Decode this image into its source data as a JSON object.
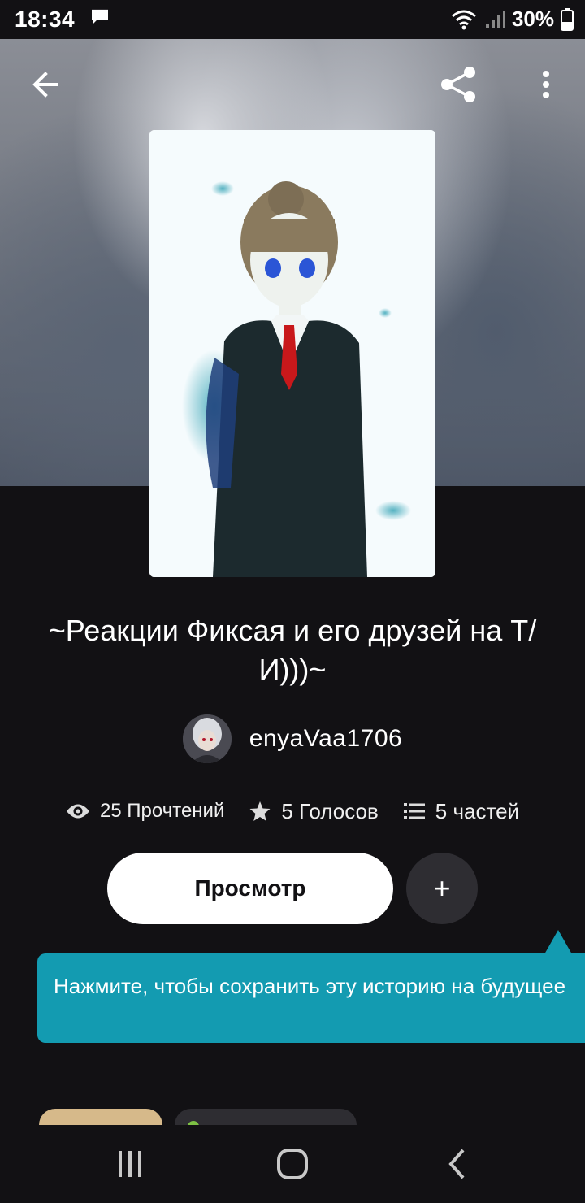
{
  "status_bar": {
    "time": "18:34",
    "battery_percent": "30%",
    "icons": [
      "message-icon",
      "wifi-icon",
      "signal-icon",
      "battery-icon"
    ]
  },
  "top_bar": {
    "icons": [
      "back-arrow-icon",
      "share-icon",
      "more-vertical-icon"
    ]
  },
  "story": {
    "title": "~Реакции Фиксая и его друзей на Т/И)))~",
    "author": "enyaVaa1706"
  },
  "stats": {
    "reads": "25 Прочтений",
    "votes": "5 Голосов",
    "parts": "5 частей"
  },
  "actions": {
    "view_label": "Просмотр",
    "add_label": "+"
  },
  "tooltip": {
    "text": "Нажмите, чтобы сохранить эту историю на будущее"
  },
  "nav_bar": {
    "icons": [
      "recent-apps-icon",
      "home-icon",
      "back-icon"
    ]
  },
  "colors": {
    "background": "#121114",
    "tooltip": "#139bb1",
    "primary_button": "#ffffff",
    "secondary_button": "#2e2d32"
  }
}
